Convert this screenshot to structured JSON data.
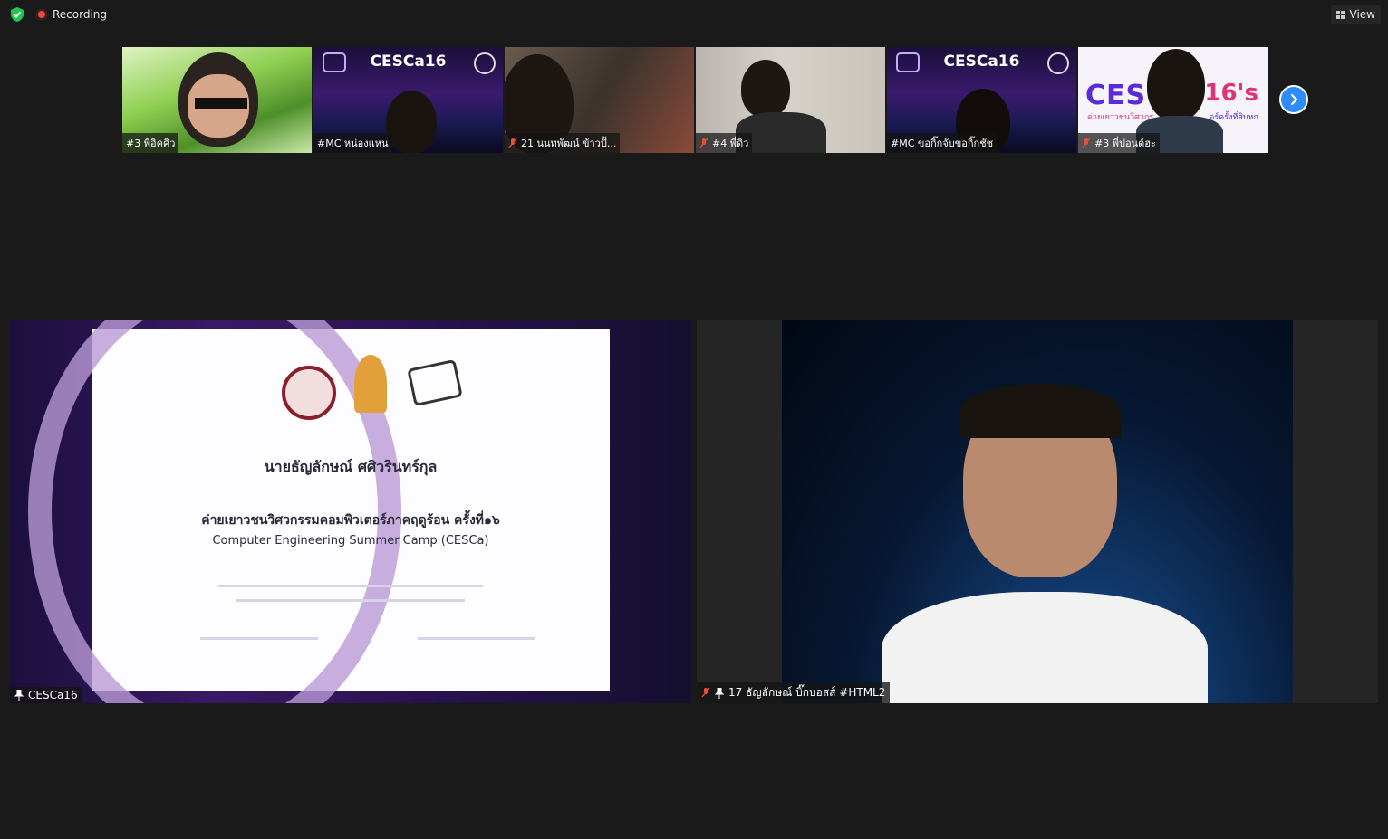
{
  "topbar": {
    "recording_label": "Recording",
    "view_label": "View",
    "security_icon": "shield-check-icon",
    "colors": {
      "recording": "#e74c3c",
      "security": "#23c552"
    }
  },
  "thumbnails": [
    {
      "name": "#3 พี่อิคคิว",
      "muted": false
    },
    {
      "name": "#MC หน่องแหน",
      "muted": false,
      "banner": "CESCa16"
    },
    {
      "name": "21 นนทพัฒน์ ข้าวปั้...",
      "muted": true
    },
    {
      "name": "#4 พี่ดิว",
      "muted": true
    },
    {
      "name": "#MC ขอกิ๊กจับขอกิ๊กชัช",
      "muted": false,
      "banner": "CESCa16"
    },
    {
      "name": "#3 พี่ปอนด์ฮะ",
      "muted": true,
      "banner_left": "CES",
      "banner_right": "16's",
      "banner_sub_left": "ค่ายเยาวชนวิศวกร",
      "banner_sub_right": "อร์ครั้งที่สิบหก"
    }
  ],
  "strip_next_icon": "chevron-right-icon",
  "main": {
    "left_tile": {
      "name": "CESCa16",
      "certificate": {
        "line1": "ค่ายเยาวชนวิศวกรรมคอมพิวเตอร์ภาคฤดูร้อน ครั้งที่๑๖",
        "line2": "Computer Engineering Summer Camp (CESCa)",
        "recipient": "นายธัญลักษณ์ ศศิวรินทร์กุล"
      }
    },
    "right_tile": {
      "name": "17 ธัญลักษณ์ บิ๊กบอสส์ #HTML2",
      "muted": true
    },
    "colors": {
      "accent": "#2d8cff"
    }
  }
}
